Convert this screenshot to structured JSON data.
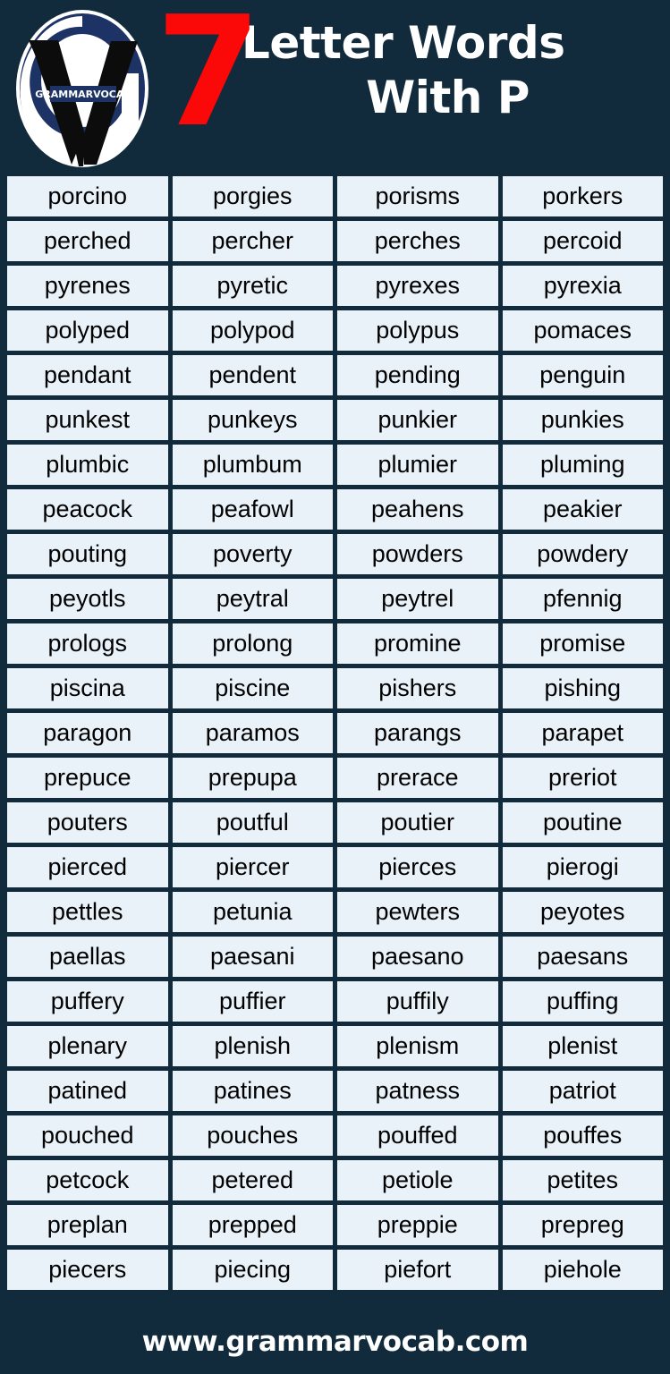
{
  "theme": {
    "background": "#112a3c",
    "cell_background": "#e9f2f9",
    "accent_red": "#fb0808",
    "text_light": "#ffffff",
    "text_dark": "#000000",
    "logo_navy": "#1d3366"
  },
  "header": {
    "number": "7",
    "title_line1": "Letter Words",
    "title_line2": "With P",
    "logo_text": "GRAMMARVOCAB"
  },
  "grid": {
    "columns": 4,
    "rows": 25,
    "words": [
      "porcino",
      "porgies",
      "porisms",
      "porkers",
      "perched",
      "percher",
      "perches",
      "percoid",
      "pyrenes",
      "pyretic",
      "pyrexes",
      "pyrexia",
      "polyped",
      "polypod",
      "polypus",
      "pomaces",
      "pendant",
      "pendent",
      "pending",
      "penguin",
      "punkest",
      "punkeys",
      "punkier",
      "punkies",
      "plumbic",
      "plumbum",
      "plumier",
      "pluming",
      "peacock",
      "peafowl",
      "peahens",
      "peakier",
      "pouting",
      "poverty",
      "powders",
      "powdery",
      "peyotls",
      "peytral",
      "peytrel",
      "pfennig",
      "prologs",
      "prolong",
      "promine",
      "promise",
      "piscina",
      "piscine",
      "pishers",
      "pishing",
      "paragon",
      "paramos",
      "parangs",
      "parapet",
      "prepuce",
      "prepupa",
      "prerace",
      "preriot",
      "pouters",
      "poutful",
      "poutier",
      "poutine",
      "pierced",
      "piercer",
      "pierces",
      "pierogi",
      "pettles",
      "petunia",
      "pewters",
      "peyotes",
      "paellas",
      "paesani",
      "paesano",
      "paesans",
      "puffery",
      "puffier",
      "puffily",
      "puffing",
      "plenary",
      "plenish",
      "plenism",
      "plenist",
      "patined",
      "patines",
      "patness",
      "patriot",
      "pouched",
      "pouches",
      "pouffed",
      "pouffes",
      "petcock",
      "petered",
      "petiole",
      "petites",
      "preplan",
      "prepped",
      "preppie",
      "prepreg",
      "piecers",
      "piecing",
      "piefort",
      "piehole"
    ]
  },
  "footer": {
    "url": "www.grammarvocab.com"
  }
}
